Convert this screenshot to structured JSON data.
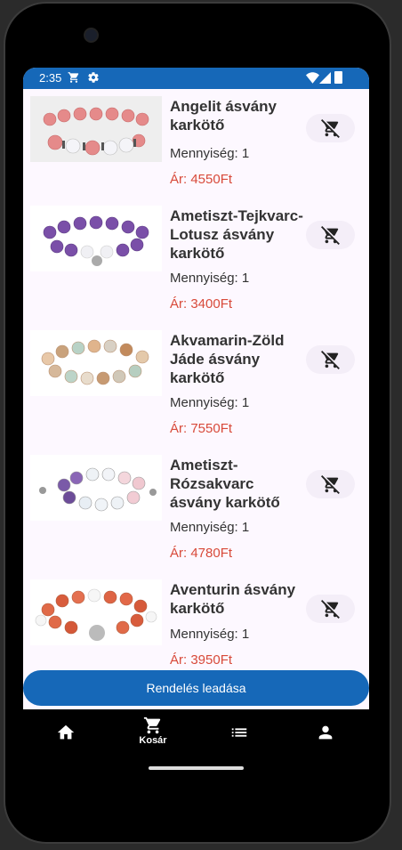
{
  "status_bar": {
    "time": "2:35"
  },
  "cart": {
    "items": [
      {
        "name": "Angelit ásvány karkötő",
        "quantity": "Mennyiség: 1",
        "price": "Ár: 4550Ft"
      },
      {
        "name": "Ametiszt-Tejkvarc-Lotusz ásvány karkötő",
        "quantity": "Mennyiség: 1",
        "price": "Ár: 3400Ft"
      },
      {
        "name": "Akvamarin-Zöld Jáde ásvány karkötő",
        "quantity": "Mennyiség: 1",
        "price": "Ár: 7550Ft"
      },
      {
        "name": "Ametiszt-Rózsakvarc ásvány karkötő",
        "quantity": "Mennyiség: 1",
        "price": "Ár: 4780Ft"
      },
      {
        "name": "Aventurin ásvány karkötő",
        "quantity": "Mennyiség: 1",
        "price": "Ár: 3950Ft"
      }
    ]
  },
  "order_button": {
    "label": "Rendelés leadása"
  },
  "nav": {
    "cart_label": "Kosár"
  },
  "colors": {
    "primary": "#1668b8",
    "price": "#d84a3a",
    "background": "#fdf8ff"
  }
}
